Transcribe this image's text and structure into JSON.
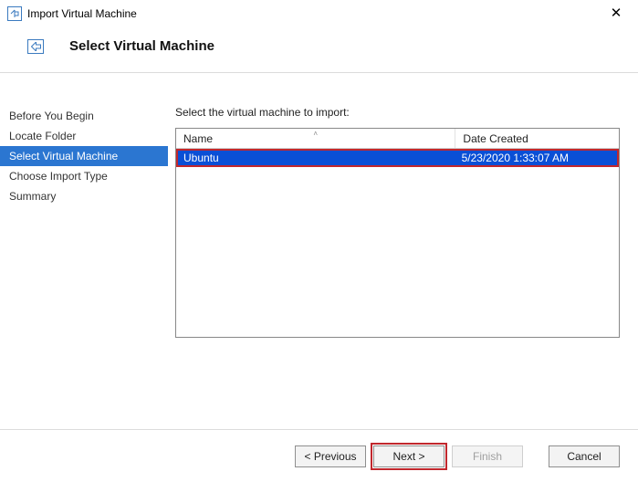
{
  "window": {
    "title": "Import Virtual Machine"
  },
  "header": {
    "page_title": "Select Virtual Machine"
  },
  "sidebar": {
    "steps": [
      {
        "label": "Before You Begin"
      },
      {
        "label": "Locate Folder"
      },
      {
        "label": "Select Virtual Machine"
      },
      {
        "label": "Choose Import Type"
      },
      {
        "label": "Summary"
      }
    ]
  },
  "content": {
    "instruction": "Select the virtual machine to import:",
    "table": {
      "col_name": "Name",
      "col_date": "Date Created",
      "rows": [
        {
          "name": "Ubuntu",
          "date_created": "5/23/2020 1:33:07 AM"
        }
      ]
    }
  },
  "footer": {
    "previous": "< Previous",
    "next": "Next >",
    "finish": "Finish",
    "cancel": "Cancel"
  }
}
